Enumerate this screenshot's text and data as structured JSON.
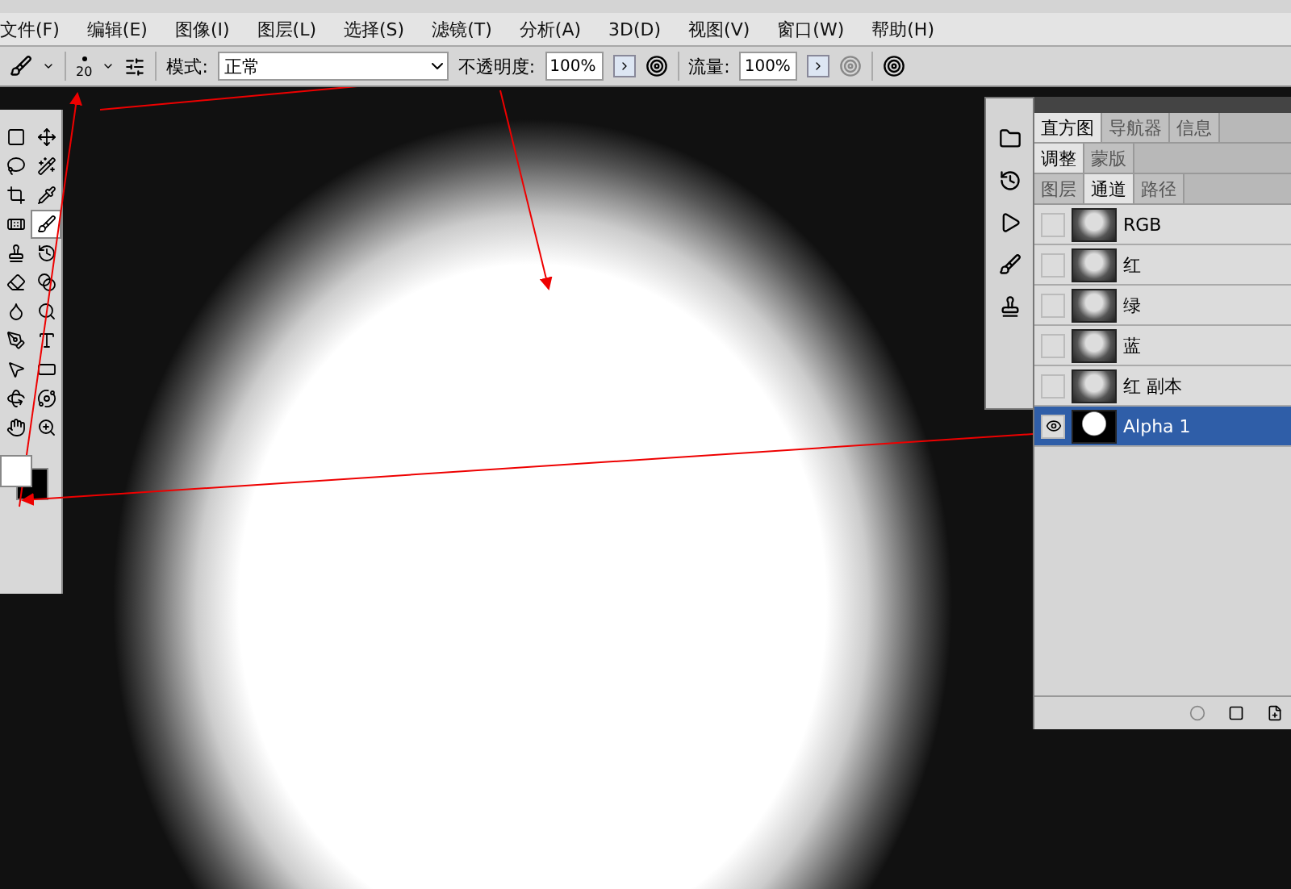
{
  "menu": [
    "文件(F)",
    "编辑(E)",
    "图像(I)",
    "图层(L)",
    "选择(S)",
    "滤镜(T)",
    "分析(A)",
    "3D(D)",
    "视图(V)",
    "窗口(W)",
    "帮助(H)"
  ],
  "options": {
    "brush_size": "20",
    "mode_label": "模式:",
    "mode_value": "正常",
    "opacity_label": "不透明度:",
    "opacity_value": "100%",
    "flow_label": "流量:",
    "flow_value": "100%"
  },
  "toolbox": {
    "tools": [
      {
        "kind": "marquee",
        "selected": false
      },
      {
        "kind": "move",
        "selected": false
      },
      {
        "kind": "lasso",
        "selected": false
      },
      {
        "kind": "quick-select",
        "selected": false
      },
      {
        "kind": "crop",
        "selected": false
      },
      {
        "kind": "eyedropper",
        "selected": false
      },
      {
        "kind": "heal",
        "selected": false
      },
      {
        "kind": "brush",
        "selected": true
      },
      {
        "kind": "stamp",
        "selected": false
      },
      {
        "kind": "history",
        "selected": false
      },
      {
        "kind": "eraser",
        "selected": false
      },
      {
        "kind": "gradient",
        "selected": false
      },
      {
        "kind": "blur",
        "selected": false
      },
      {
        "kind": "dodge",
        "selected": false
      },
      {
        "kind": "pen",
        "selected": false
      },
      {
        "kind": "type",
        "selected": false
      },
      {
        "kind": "path-select",
        "selected": false
      },
      {
        "kind": "shape",
        "selected": false
      },
      {
        "kind": "rotate3d",
        "selected": false
      },
      {
        "kind": "orbit3d",
        "selected": false
      },
      {
        "kind": "hand",
        "selected": false
      },
      {
        "kind": "zoom",
        "selected": false
      }
    ]
  },
  "panel": {
    "tab_groups": [
      [
        {
          "label": "直方图",
          "selected": true
        },
        {
          "label": "导航器",
          "selected": false
        },
        {
          "label": "信息",
          "selected": false
        }
      ],
      [
        {
          "label": "调整",
          "selected": true
        },
        {
          "label": "蒙版",
          "selected": false
        }
      ],
      [
        {
          "label": "图层",
          "selected": false
        },
        {
          "label": "通道",
          "selected": true
        },
        {
          "label": "路径",
          "selected": false
        }
      ]
    ],
    "channels": [
      {
        "name": "RGB",
        "visible": false,
        "selected": false
      },
      {
        "name": "红",
        "visible": false,
        "selected": false
      },
      {
        "name": "绿",
        "visible": false,
        "selected": false
      },
      {
        "name": "蓝",
        "visible": false,
        "selected": false
      },
      {
        "name": "红 副本",
        "visible": false,
        "selected": false
      },
      {
        "name": "Alpha 1",
        "visible": true,
        "selected": true
      }
    ]
  }
}
